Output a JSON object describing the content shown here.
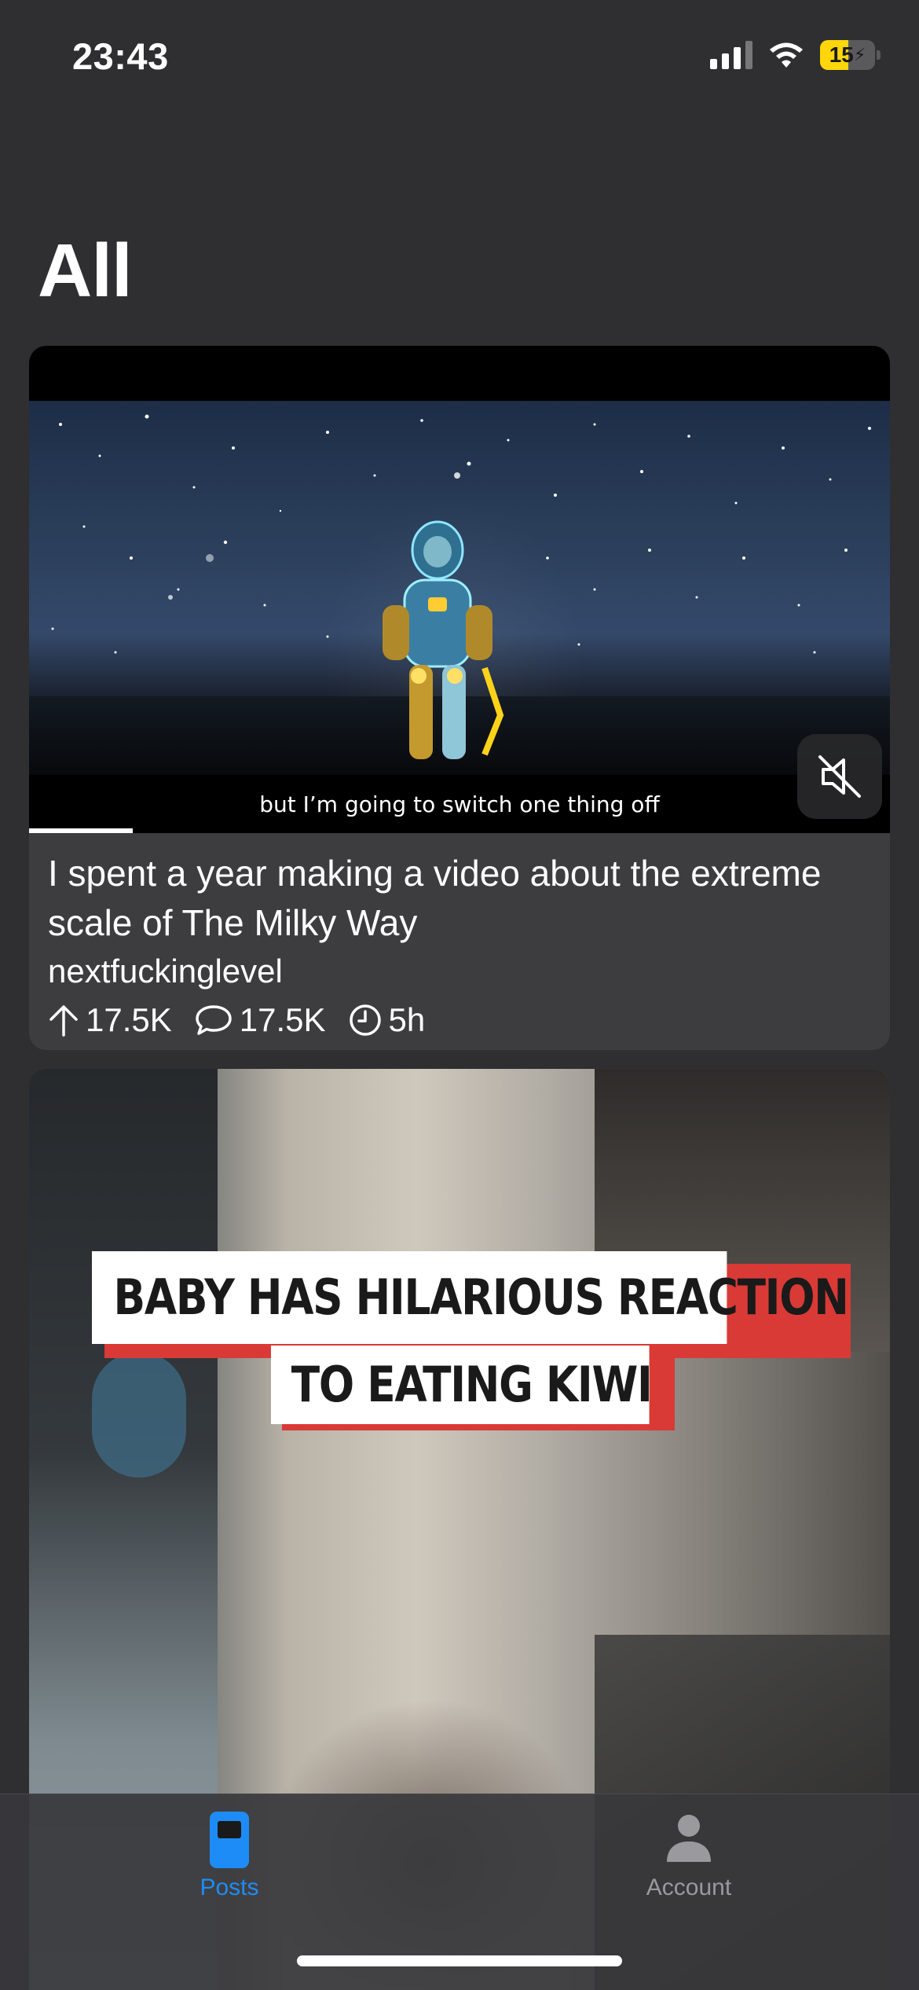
{
  "status_bar": {
    "time": "23:43",
    "battery": "15",
    "battery_color": "#ffd60a"
  },
  "header": {
    "title": "All"
  },
  "posts": [
    {
      "media_type": "video",
      "subtitle": "but I’m going to switch one thing off",
      "progress_fraction": 0.12,
      "muted": true,
      "title": "I spent a year making a video about the extreme scale of The Milky Way",
      "subreddit": "nextfuckinglevel",
      "upvotes": "17.5K",
      "comments": "17.5K",
      "age": "5h"
    },
    {
      "media_type": "video",
      "overlay_line_1": "BABY HAS HILARIOUS REACTION",
      "overlay_line_2": "TO EATING KIWI"
    }
  ],
  "tab_bar": {
    "tabs": [
      {
        "label": "Posts",
        "icon": "phone-icon",
        "active": true,
        "color": "#1e8cf6"
      },
      {
        "label": "Account",
        "icon": "person-icon",
        "active": false,
        "color": "#9a9a9e"
      }
    ]
  }
}
